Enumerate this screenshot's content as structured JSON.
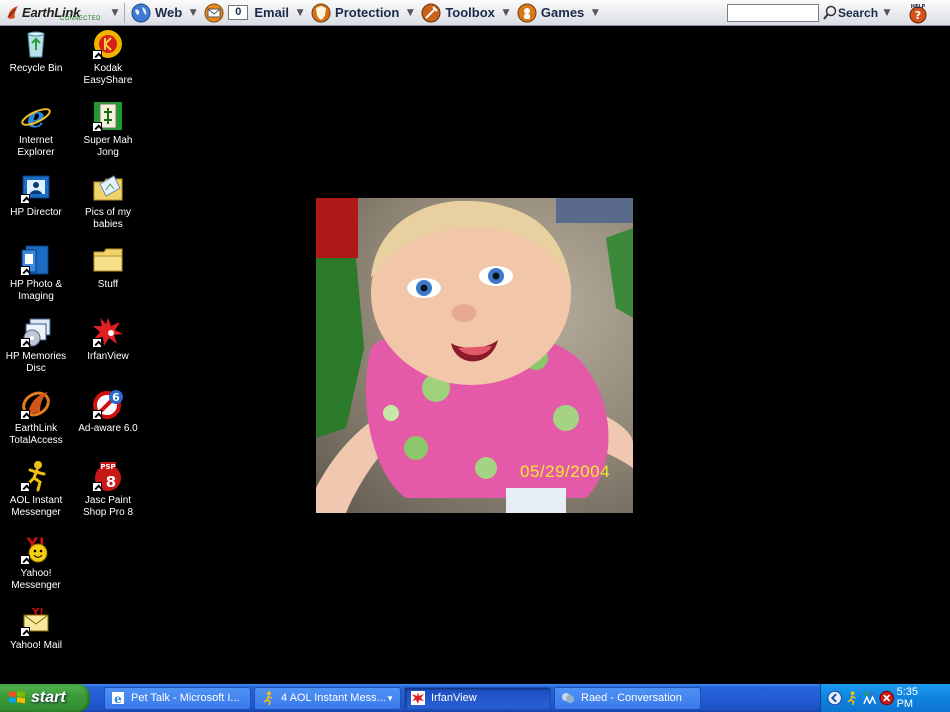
{
  "toolbar": {
    "brand": "EarthLink",
    "brand_sub": "CONNECTED",
    "buttons": [
      {
        "label": "Web"
      },
      {
        "label": "Email",
        "count": "0"
      },
      {
        "label": "Protection"
      },
      {
        "label": "Toolbox"
      },
      {
        "label": "Games"
      }
    ],
    "search_value": "",
    "search_label": "Search",
    "help_label": "HELP"
  },
  "desktop": {
    "icons": [
      {
        "label": "Recycle Bin"
      },
      {
        "label": "Kodak EasyShare"
      },
      {
        "label": "Internet Explorer"
      },
      {
        "label": "Super Mah Jong"
      },
      {
        "label": "HP Director"
      },
      {
        "label": "Pics of my babies"
      },
      {
        "label": "HP Photo & Imaging"
      },
      {
        "label": "Stuff"
      },
      {
        "label": "HP Memories Disc"
      },
      {
        "label": "IrfanView"
      },
      {
        "label": "EarthLink TotalAccess"
      },
      {
        "label": "Ad-aware 6.0"
      },
      {
        "label": "AOL Instant Messenger"
      },
      {
        "label": "Jasc Paint Shop Pro 8"
      },
      {
        "label": "Yahoo! Messenger"
      },
      {
        "label": "Yahoo! Mail"
      }
    ]
  },
  "photo": {
    "date_stamp": "05/29/2004"
  },
  "taskbar": {
    "start_label": "start",
    "tasks": [
      {
        "label": "Pet Talk - Microsoft I..."
      },
      {
        "label": "4 AOL Instant Mess..."
      },
      {
        "label": "IrfanView"
      },
      {
        "label": "Raed - Conversation"
      }
    ],
    "clock": "5:35 PM"
  },
  "colors": {
    "taskbar_blue": "#245dd7",
    "start_green": "#3c9c3a",
    "tray_blue": "#0f83e0",
    "date_yellow": "#f4e833"
  }
}
